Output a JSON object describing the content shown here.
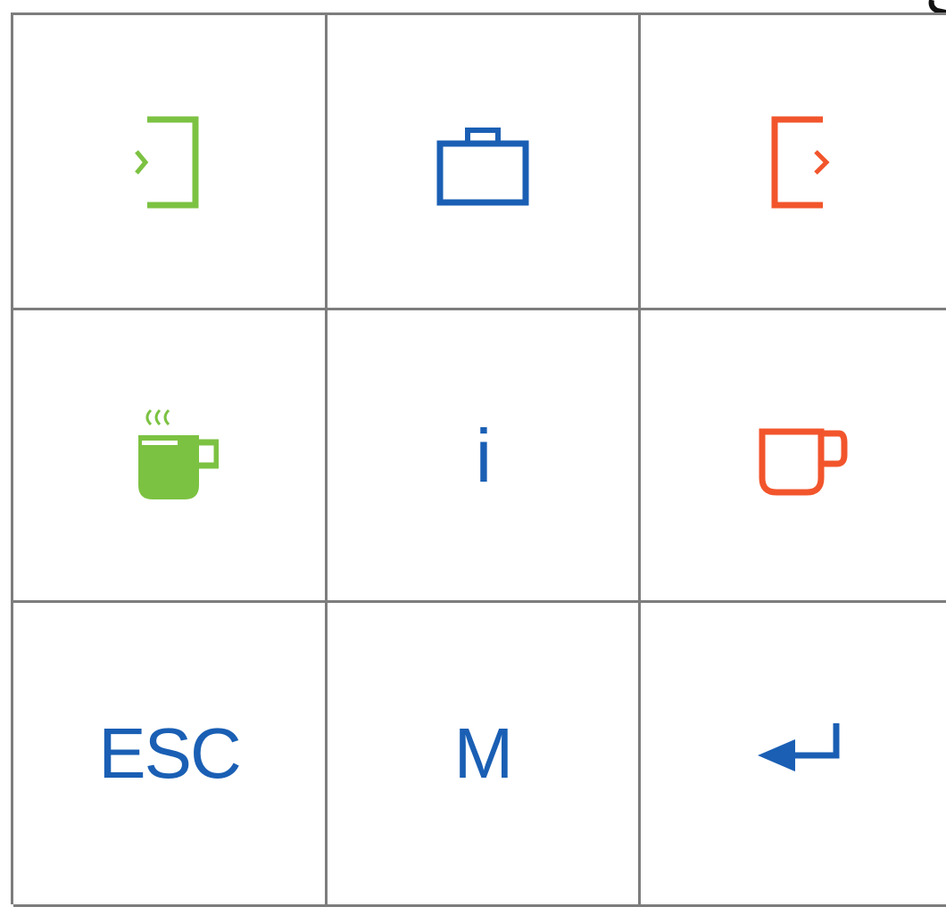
{
  "colors": {
    "green": "#7cc242",
    "blue": "#1a5fb4",
    "orange": "#f2552c",
    "grid": "#7d7d7d"
  },
  "keys": [
    {
      "icon": "login-icon",
      "color": "green"
    },
    {
      "icon": "briefcase-icon",
      "color": "blue"
    },
    {
      "icon": "logout-icon",
      "color": "orange"
    },
    {
      "icon": "hot-coffee-icon",
      "color": "green"
    },
    {
      "label": "i",
      "color": "blue"
    },
    {
      "icon": "cup-icon",
      "color": "orange"
    },
    {
      "label": "ESC",
      "color": "blue"
    },
    {
      "label": "M",
      "color": "blue"
    },
    {
      "icon": "enter-arrow-icon",
      "color": "blue"
    }
  ]
}
